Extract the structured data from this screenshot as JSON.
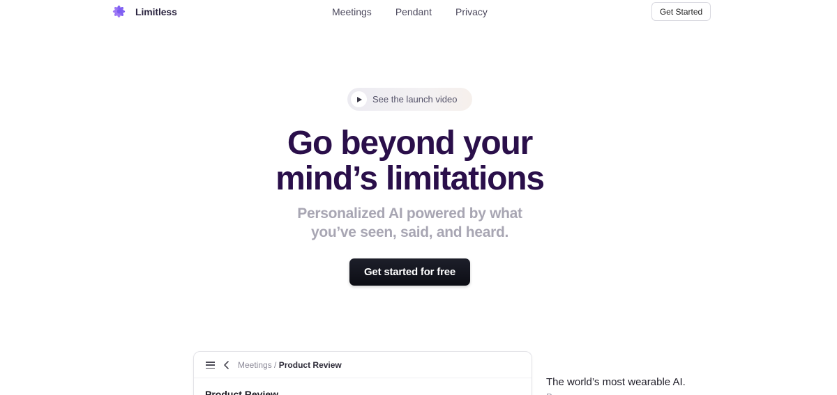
{
  "header": {
    "logo_text": "Limitless",
    "logo_icon": "limitless-flower-logo",
    "nav": [
      {
        "label": "Meetings"
      },
      {
        "label": "Pendant"
      },
      {
        "label": "Privacy"
      }
    ],
    "get_started_label": "Get Started"
  },
  "hero": {
    "launch_video_label": "See the launch video",
    "headline_line1": "Go beyond your",
    "headline_line2": "mind’s limitations",
    "subhead_line1": "Personalized AI powered by what",
    "subhead_line2": "you’ve seen, said, and heard.",
    "cta_label": "Get started for free"
  },
  "app_preview": {
    "breadcrumb_parent": "Meetings",
    "breadcrumb_separator": "/",
    "breadcrumb_current": "Product Review",
    "title": "Product Review"
  },
  "wearable": {
    "heading": "The world’s most wearable AI.",
    "subtext": "P"
  },
  "colors": {
    "headline": "#2a0f4a",
    "subhead": "#a8a6b3",
    "cta_bg": "#12131c",
    "logo_accent": "#8a5cf0"
  }
}
